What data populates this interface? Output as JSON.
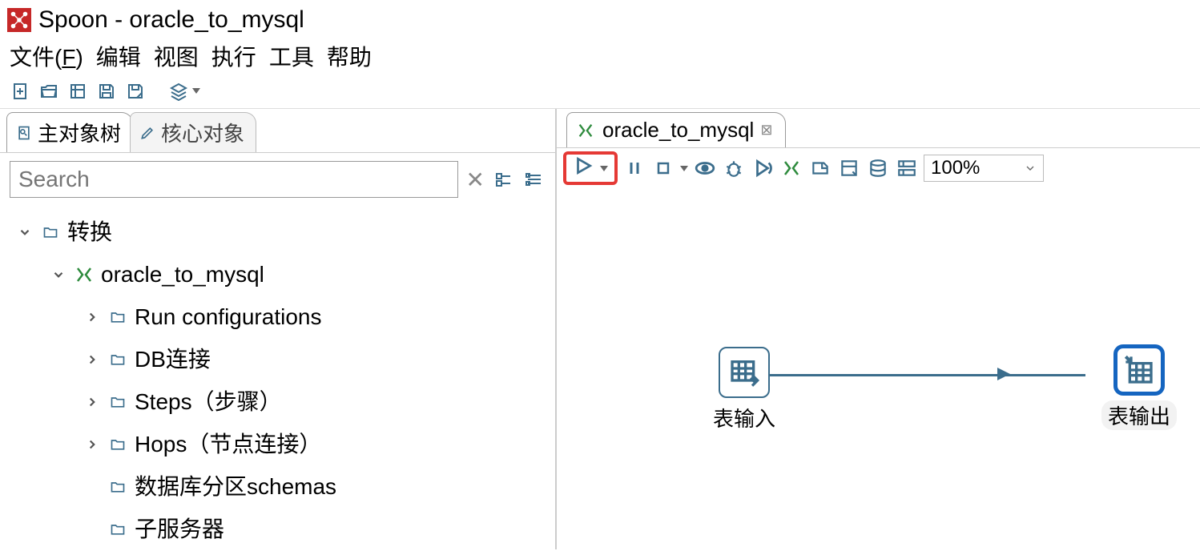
{
  "title": "Spoon - oracle_to_mysql",
  "menu": {
    "file": "文件(F)",
    "file_pre": "文件(",
    "file_u": "F",
    "file_post": ")",
    "edit": "编辑",
    "view": "视图",
    "run": "执行",
    "tools": "工具",
    "help": "帮助"
  },
  "left": {
    "tab_main": "主对象树",
    "tab_core": "核心对象",
    "search_placeholder": "Search",
    "tree": {
      "root": "转换",
      "transformation": "oracle_to_mysql",
      "children": {
        "runconf": "Run configurations",
        "db": "DB连接",
        "steps": "Steps（步骤）",
        "hops": "Hops（节点连接）",
        "schemas": "数据库分区schemas",
        "sub": "子服务器"
      }
    }
  },
  "editor": {
    "tab_label": "oracle_to_mysql",
    "zoom": "100%",
    "step_input": "表输入",
    "step_output": "表输出"
  }
}
